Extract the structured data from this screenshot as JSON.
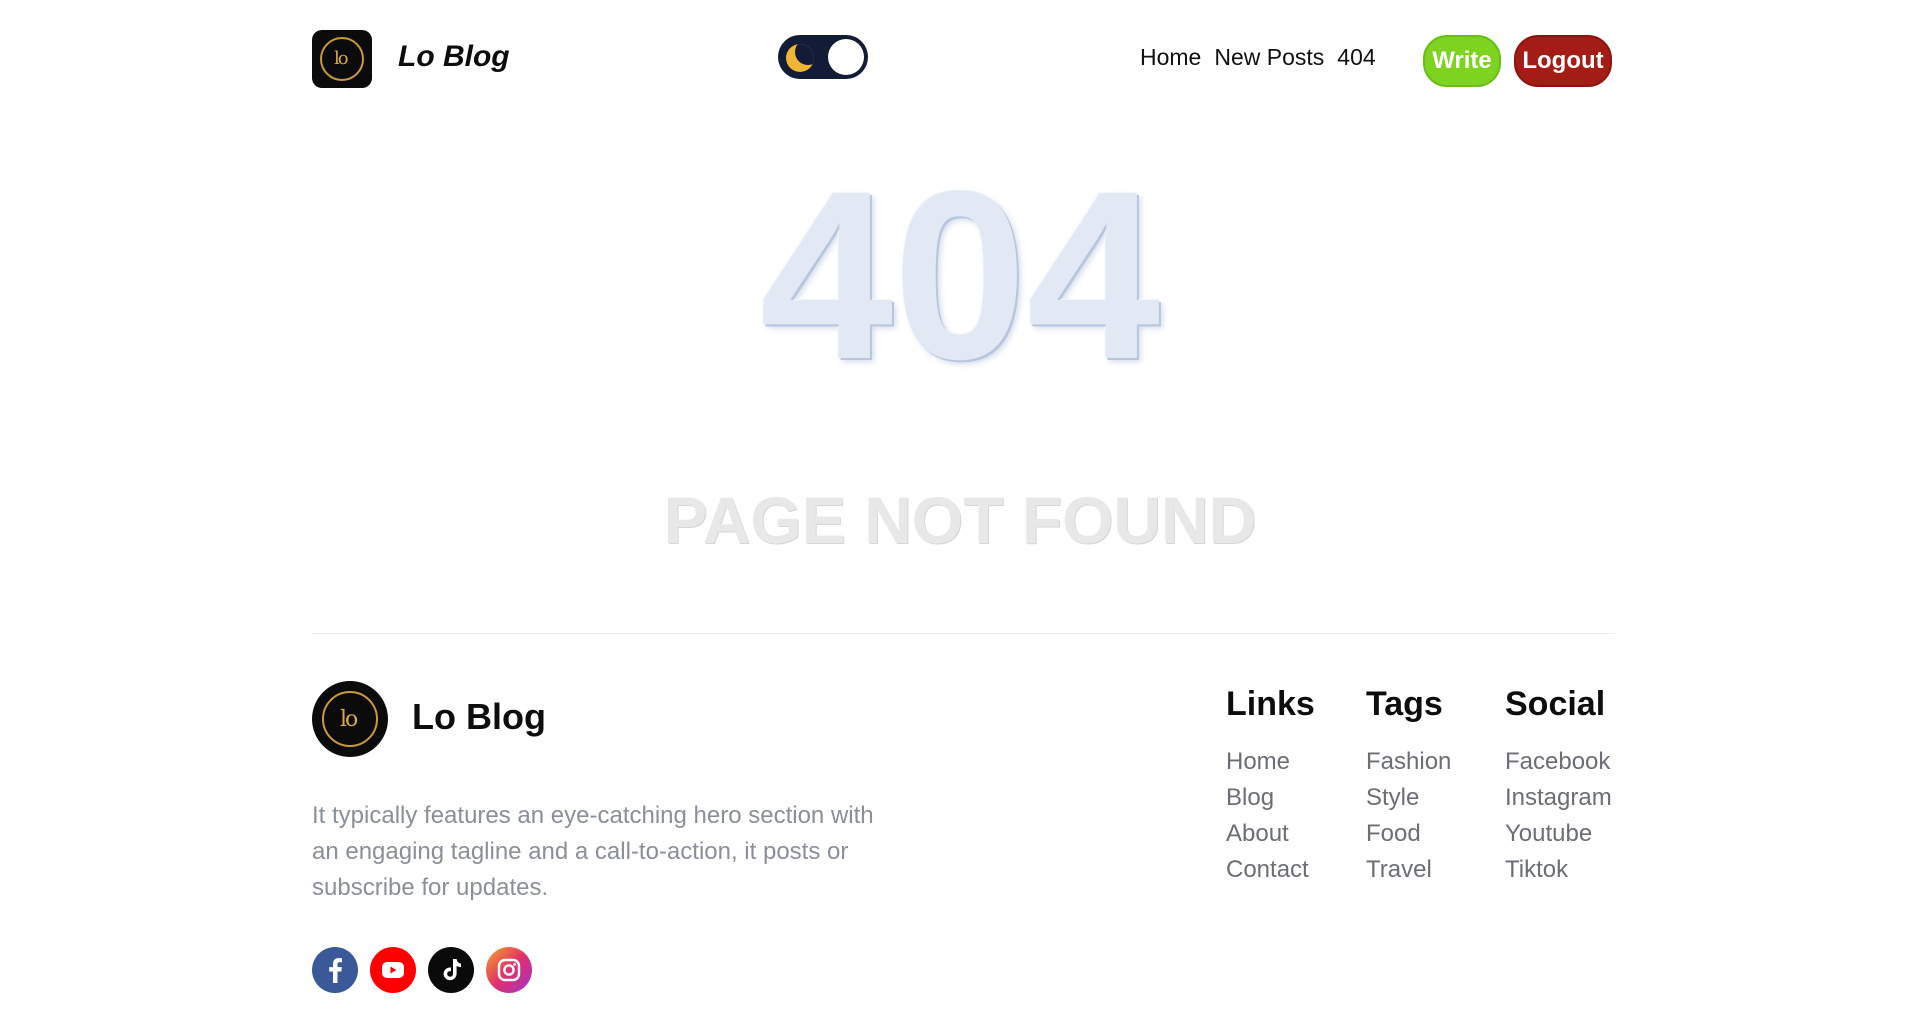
{
  "header": {
    "brand": "Lo Blog",
    "nav": [
      "Home",
      "New Posts",
      "404"
    ],
    "write_label": "Write",
    "logout_label": "Logout",
    "theme_toggle": "dark-mode-toggle"
  },
  "main": {
    "code": "404",
    "message": "PAGE NOT FOUND"
  },
  "footer": {
    "brand": "Lo Blog",
    "description": "It typically features an eye-catching hero section with an engaging tagline and a call-to-action, it posts or subscribe for updates.",
    "social_icons": [
      "facebook-icon",
      "youtube-icon",
      "tiktok-icon",
      "instagram-icon"
    ],
    "columns": {
      "links": {
        "title": "Links",
        "items": [
          "Home",
          "Blog",
          "About",
          "Contact"
        ]
      },
      "tags": {
        "title": "Tags",
        "items": [
          "Fashion",
          "Style",
          "Food",
          "Travel"
        ]
      },
      "social": {
        "title": "Social",
        "items": [
          "Facebook",
          "Instagram",
          "Youtube",
          "Tiktok"
        ]
      }
    }
  },
  "colors": {
    "write": "#7ed321",
    "logout": "#a31c16",
    "toggle_bg": "#131c37",
    "moon": "#f0b535"
  }
}
